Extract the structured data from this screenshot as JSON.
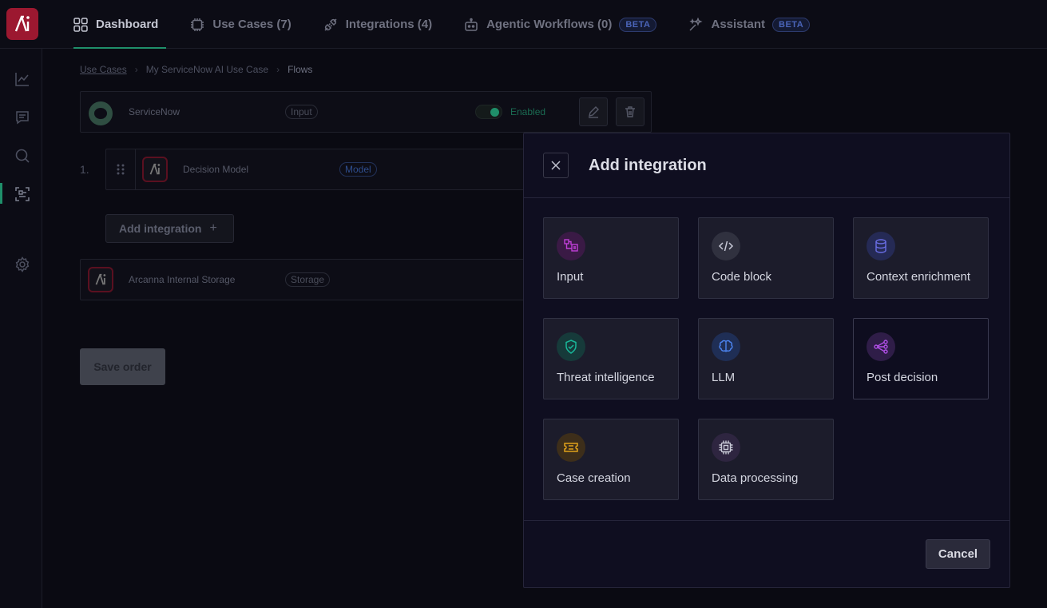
{
  "nav": {
    "items": [
      {
        "label": "Dashboard",
        "icon": "grid-icon",
        "active": true
      },
      {
        "label": "Use Cases (7)",
        "icon": "chip-icon"
      },
      {
        "label": "Integrations (4)",
        "icon": "plug-icon"
      },
      {
        "label": "Agentic Workflows (0)",
        "icon": "robot-icon",
        "badge": "BETA"
      },
      {
        "label": "Assistant",
        "icon": "sparkle-icon",
        "badge": "BETA"
      }
    ]
  },
  "breadcrumb": {
    "use_cases": "Use Cases",
    "use_case_name": "My ServiceNow AI Use Case",
    "current": "Flows"
  },
  "flow": {
    "input_row": {
      "name": "ServiceNow",
      "type": "Input",
      "status": "Enabled"
    },
    "model_row": {
      "step": "1.",
      "name": "Decision Model",
      "type": "Model"
    },
    "add_integration_label": "Add integration",
    "storage_row": {
      "name": "Arcanna Internal Storage",
      "type": "Storage"
    },
    "save_label": "Save order"
  },
  "modal": {
    "title": "Add integration",
    "cards": [
      {
        "label": "Input",
        "icon": "input-icon",
        "color": "#c13fd8"
      },
      {
        "label": "Code block",
        "icon": "code-icon",
        "color": "#b8bacb"
      },
      {
        "label": "Context enrichment",
        "icon": "database-icon",
        "color": "#6a6ee6"
      },
      {
        "label": "Threat intelligence",
        "icon": "shield-icon",
        "color": "#19b89a"
      },
      {
        "label": "LLM",
        "icon": "brain-icon",
        "color": "#4c84f0"
      },
      {
        "label": "Post decision",
        "icon": "share-icon",
        "color": "#b04fe6"
      },
      {
        "label": "Case creation",
        "icon": "ticket-icon",
        "color": "#e0a21a"
      },
      {
        "label": "Data processing",
        "icon": "processor-icon",
        "color": "#c8c9d6"
      }
    ],
    "cancel_label": "Cancel"
  }
}
